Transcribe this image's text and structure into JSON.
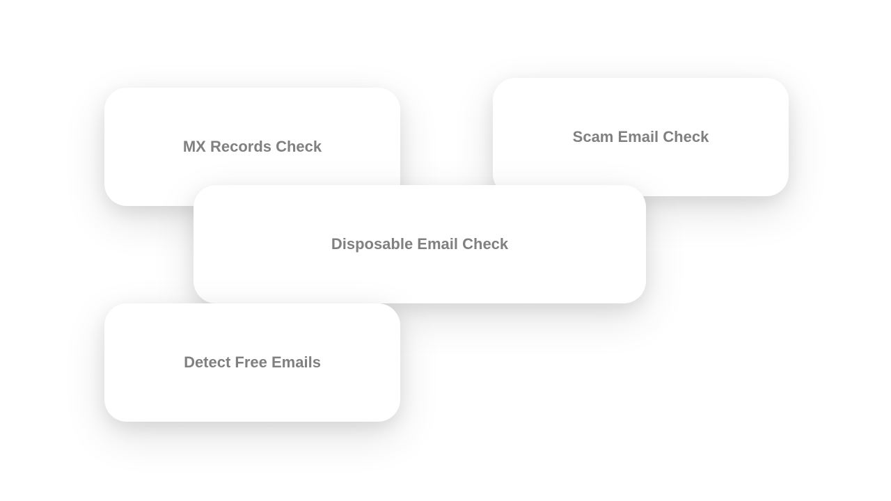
{
  "cards": {
    "mx": {
      "label": "MX Records Check"
    },
    "scam": {
      "label": "Scam Email Check"
    },
    "disposable": {
      "label": "Disposable Email Check"
    },
    "free": {
      "label": "Detect Free Emails"
    }
  }
}
